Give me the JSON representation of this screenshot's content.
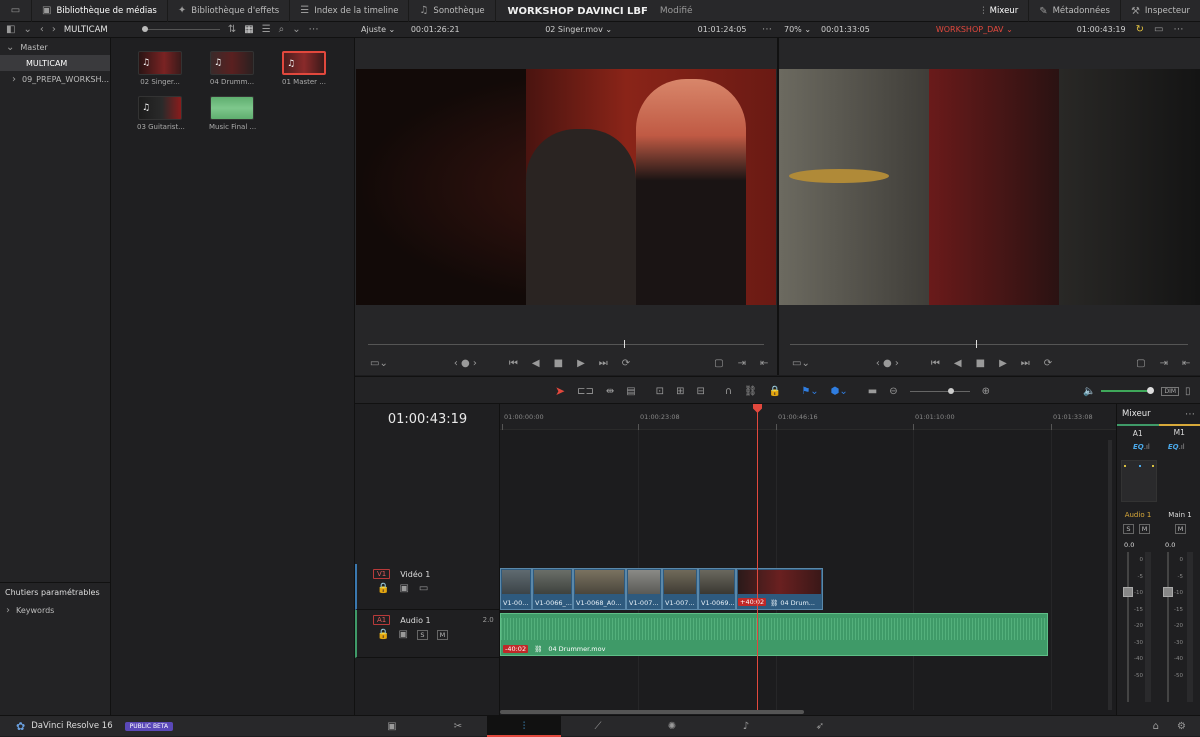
{
  "top_tabs": [
    {
      "label": "Bibliothèque de médias",
      "icon": "media-pool-icon"
    },
    {
      "label": "Bibliothèque d'effets",
      "icon": "effects-library-icon"
    },
    {
      "label": "Index de la timeline",
      "icon": "edit-index-icon"
    },
    {
      "label": "Sonothèque",
      "icon": "sound-library-icon"
    }
  ],
  "project": {
    "title": "WORKSHOP DAVINCI LBF",
    "status": "Modifié"
  },
  "right_tabs": [
    {
      "label": "Mixeur",
      "icon": "mixer-icon"
    },
    {
      "label": "Métadonnées",
      "icon": "metadata-icon"
    },
    {
      "label": "Inspecteur",
      "icon": "inspector-icon"
    }
  ],
  "pool_bar": {
    "bin": "MULTICAM"
  },
  "source_bar": {
    "zoom": "Ajuste",
    "timecode": "00:01:26:21",
    "clip": "02 Singer.mov",
    "duration": "01:01:24:05"
  },
  "record_bar": {
    "zoom": "70%",
    "timecode": "00:01:33:05",
    "timeline": "WORKSHOP_DAV",
    "duration": "01:00:43:19"
  },
  "sidebar": {
    "root": "Master",
    "items": [
      "MULTICAM",
      "09_PREPA_WORKSH..."
    ],
    "smart_header": "Chutiers paramétrables",
    "smart_items": [
      "Keywords"
    ]
  },
  "clips": [
    {
      "label": "02 Singer..."
    },
    {
      "label": "04 Drumm..."
    },
    {
      "label": "01 Master ..."
    },
    {
      "label": "03 Guitarist..."
    },
    {
      "label": "Music Final ..."
    }
  ],
  "timeline": {
    "timecode": "01:00:43:19",
    "ruler": [
      "01:00:00:00",
      "01:00:23:08",
      "01:00:46:16",
      "01:01:10:00",
      "01:01:33:08"
    ],
    "video_track": {
      "badge": "V1",
      "name": "Vidéo 1"
    },
    "audio_track": {
      "badge": "A1",
      "name": "Audio 1",
      "channels": "2.0",
      "solo": "S",
      "mute": "M"
    },
    "video_clips": [
      "V1-00...",
      "V1-0066_...",
      "V1-0068_A0...",
      "V1-007...",
      "V1-007...",
      "V1-0069...",
      "04 Drum..."
    ],
    "offset_video": "+40:02",
    "offset_audio": "-40:02",
    "audio_clip": "04 Drummer.mov"
  },
  "mixer": {
    "title": "Mixeur",
    "ch1": "A1",
    "ch2": "M1",
    "eq": "EQ",
    "strip1": "Audio 1",
    "strip2": "Main 1",
    "solo": "S",
    "mute": "M",
    "level1": "0.0",
    "level2": "0.0",
    "scale": [
      "0",
      "-5",
      "-10",
      "-15",
      "-20",
      "-30",
      "-40",
      "-50"
    ]
  },
  "dim_label": "DIM",
  "app": {
    "name": "DaVinci Resolve 16",
    "badge": "PUBLIC BETA"
  },
  "colors": {
    "accent_red": "#e2483d",
    "video_clip": "#2e5a7e",
    "audio_clip": "#3f9a68",
    "beta_badge": "#5a48b8",
    "mixer_yellow": "#d8a93a"
  }
}
